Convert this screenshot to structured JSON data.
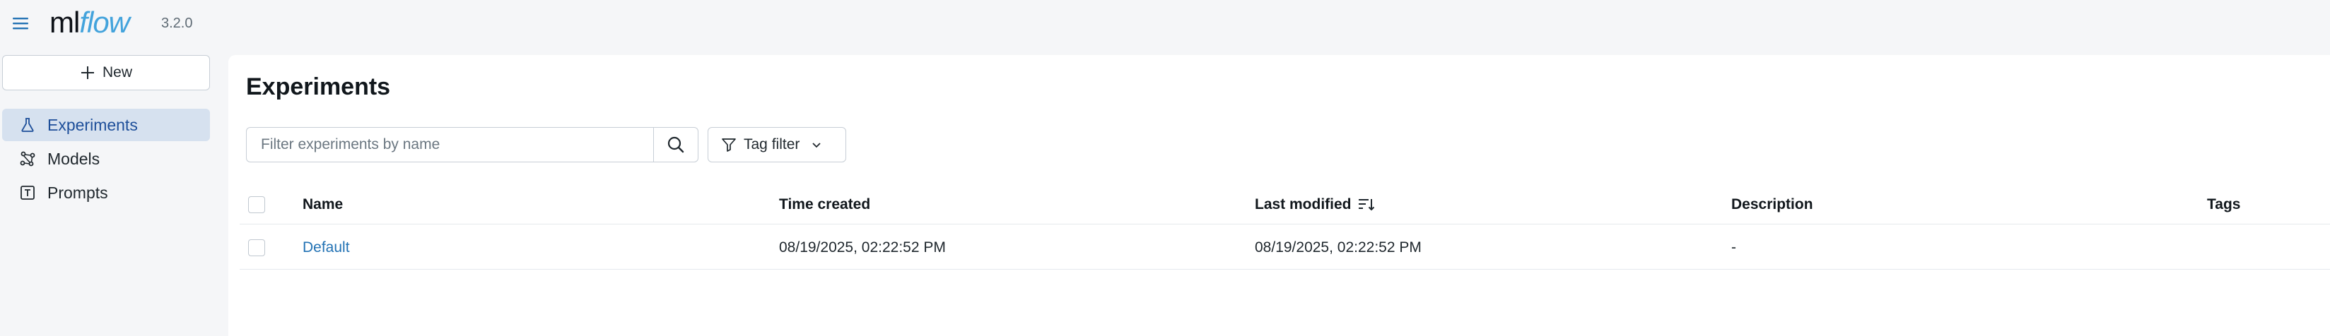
{
  "header": {
    "logo_ml": "ml",
    "logo_flow": "flow",
    "version": "3.2.0"
  },
  "sidebar": {
    "new_label": "New",
    "items": [
      {
        "label": "Experiments",
        "icon": "beaker-icon",
        "active": true
      },
      {
        "label": "Models",
        "icon": "models-icon",
        "active": false
      },
      {
        "label": "Prompts",
        "icon": "prompts-icon",
        "active": false
      }
    ]
  },
  "main": {
    "title": "Experiments",
    "search": {
      "placeholder": "Filter experiments by name",
      "value": ""
    },
    "tag_filter_label": "Tag filter",
    "table": {
      "headers": {
        "name": "Name",
        "time_created": "Time created",
        "last_modified": "Last modified",
        "description": "Description",
        "tags": "Tags"
      },
      "sort_column": "last_modified",
      "rows": [
        {
          "name": "Default",
          "time_created": "08/19/2025, 02:22:52 PM",
          "last_modified": "08/19/2025, 02:22:52 PM",
          "description": "-",
          "tags": ""
        }
      ]
    }
  },
  "colors": {
    "accent": "#2272b4",
    "active_nav_bg": "#d6e1ef",
    "logo_flow": "#43a3dc",
    "page_bg": "#f5f6f8"
  }
}
